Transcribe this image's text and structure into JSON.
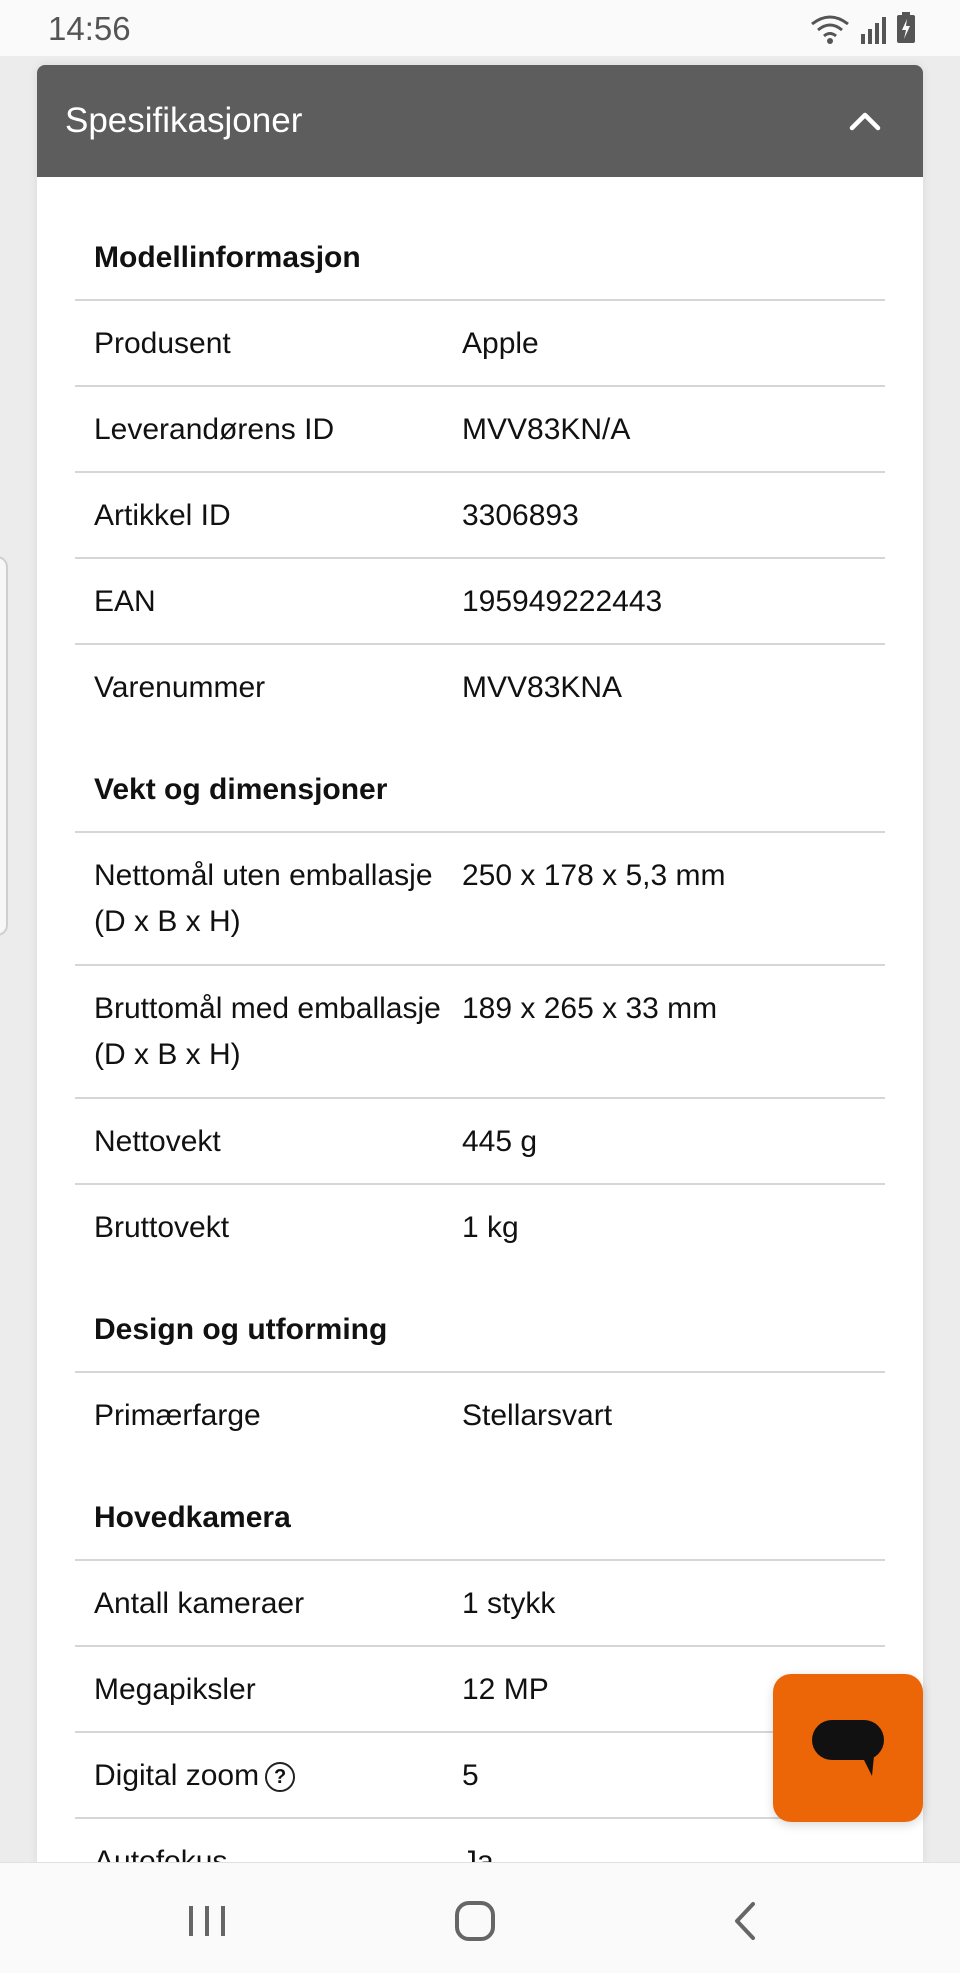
{
  "status": {
    "time": "14:56",
    "icons": [
      "wifi-icon",
      "signal-icon",
      "battery-charging-icon"
    ]
  },
  "header": {
    "title": "Spesifikasjoner",
    "toggle_icon": "chevron-up-icon"
  },
  "groups": [
    {
      "heading": "Modellinformasjon",
      "rows": [
        {
          "label": "Produsent",
          "value": "Apple"
        },
        {
          "label": "Leverandørens ID",
          "value": "MVV83KN/A"
        },
        {
          "label": "Artikkel ID",
          "value": "3306893"
        },
        {
          "label": "EAN",
          "value": "195949222443"
        },
        {
          "label": "Varenummer",
          "value": "MVV83KNA"
        }
      ]
    },
    {
      "heading": "Vekt og dimensjoner",
      "rows": [
        {
          "label": "Nettomål uten emballasje (D x B x H)",
          "value": "250 x 178 x 5,3 mm"
        },
        {
          "label": "Bruttomål med emballasje (D x B x H)",
          "value": "189 x 265 x 33 mm"
        },
        {
          "label": "Nettovekt",
          "value": "445 g"
        },
        {
          "label": "Bruttovekt",
          "value": "1 kg"
        }
      ]
    },
    {
      "heading": "Design og utforming",
      "rows": [
        {
          "label": "Primærfarge",
          "value": "Stellarsvart"
        }
      ]
    },
    {
      "heading": "Hovedkamera",
      "rows": [
        {
          "label": "Antall kameraer",
          "value": "1 stykk"
        },
        {
          "label": "Megapiksler",
          "value": "12 MP"
        },
        {
          "label": "Digital zoom",
          "value": "5",
          "help": "?"
        },
        {
          "label": "Autofokus",
          "value": "Ja"
        }
      ]
    }
  ],
  "chat": {
    "icon": "chat-bubble-icon",
    "color": "#ec6608"
  },
  "navbar": {
    "icons": [
      "recent-apps-icon",
      "home-icon",
      "back-icon"
    ]
  }
}
